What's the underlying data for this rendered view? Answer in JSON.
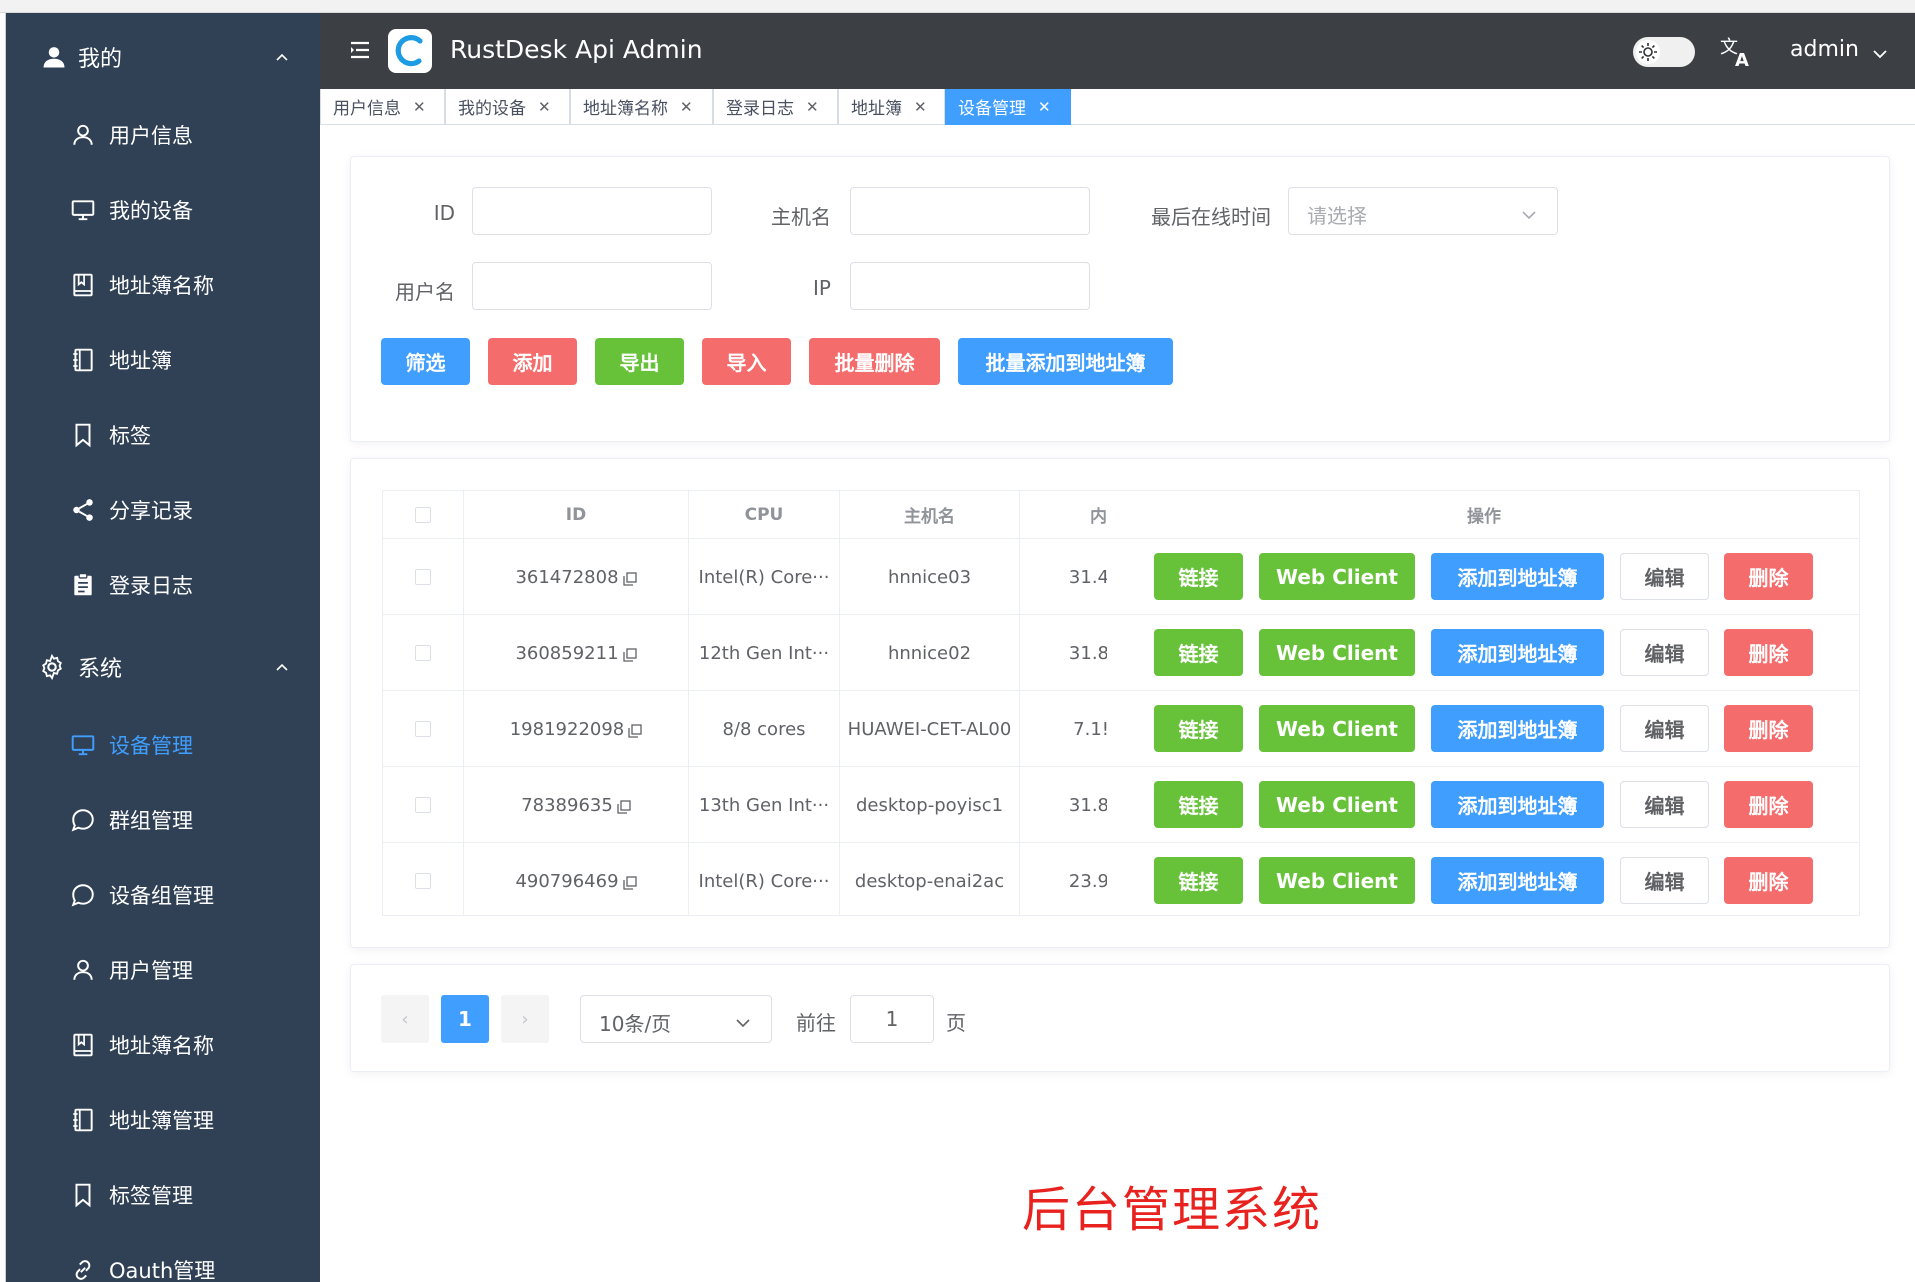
{
  "app": {
    "title": "RustDesk Api Admin",
    "user": "admin"
  },
  "sidebar": {
    "group_mine": "我的",
    "mine_items": [
      {
        "label": "用户信息",
        "icon": "user-icon"
      },
      {
        "label": "我的设备",
        "icon": "monitor-icon"
      },
      {
        "label": "地址簿名称",
        "icon": "book-icon"
      },
      {
        "label": "地址簿",
        "icon": "notebook-icon"
      },
      {
        "label": "标签",
        "icon": "bookmark-icon"
      },
      {
        "label": "分享记录",
        "icon": "share-icon"
      },
      {
        "label": "登录日志",
        "icon": "clipboard-icon"
      }
    ],
    "group_system": "系统",
    "system_items": [
      {
        "label": "设备管理",
        "icon": "monitor-icon",
        "active": true
      },
      {
        "label": "群组管理",
        "icon": "chat-icon"
      },
      {
        "label": "设备组管理",
        "icon": "chat-icon"
      },
      {
        "label": "用户管理",
        "icon": "user-icon"
      },
      {
        "label": "地址簿名称",
        "icon": "book-icon"
      },
      {
        "label": "地址簿管理",
        "icon": "notebook-icon"
      },
      {
        "label": "标签管理",
        "icon": "bookmark-icon"
      },
      {
        "label": "Oauth管理",
        "icon": "link-icon"
      }
    ]
  },
  "tabs": [
    {
      "label": "用户信息"
    },
    {
      "label": "我的设备"
    },
    {
      "label": "地址簿名称"
    },
    {
      "label": "登录日志"
    },
    {
      "label": "地址簿"
    },
    {
      "label": "设备管理",
      "active": true
    }
  ],
  "filters": {
    "id_label": "ID",
    "hostname_label": "主机名",
    "last_online_label": "最后在线时间",
    "last_online_placeholder": "请选择",
    "username_label": "用户名",
    "ip_label": "IP"
  },
  "actions": {
    "filter": "筛选",
    "add": "添加",
    "export": "导出",
    "import": "导入",
    "batch_delete": "批量删除",
    "batch_add_addressbook": "批量添加到地址簿"
  },
  "table": {
    "headers": {
      "id": "ID",
      "cpu": "CPU",
      "hostname": "主机名",
      "memory": "内",
      "ops": "操作"
    },
    "row_buttons": {
      "connect": "链接",
      "web_client": "Web Client",
      "add_to_ab": "添加到地址簿",
      "edit": "编辑",
      "delete": "删除"
    },
    "rows": [
      {
        "id": "361472808",
        "cpu": "Intel(R) Core···",
        "hostname": "hnnice03",
        "memory": "31.4"
      },
      {
        "id": "360859211",
        "cpu": "12th Gen Int···",
        "hostname": "hnnice02",
        "memory": "31.8"
      },
      {
        "id": "1981922098",
        "cpu": "8/8 cores",
        "hostname": "HUAWEI-CET-AL00",
        "memory": "7.1!"
      },
      {
        "id": "78389635",
        "cpu": "13th Gen Int···",
        "hostname": "desktop-poyisc1",
        "memory": "31.8"
      },
      {
        "id": "490796469",
        "cpu": "Intel(R) Core···",
        "hostname": "desktop-enai2ac",
        "memory": "23.9"
      }
    ]
  },
  "pagination": {
    "prev": "‹",
    "current": "1",
    "next": "›",
    "page_size": "10条/页",
    "goto_label": "前往",
    "goto_value": "1",
    "page_suffix": "页"
  },
  "watermark": "后台管理系统",
  "colors": {
    "primary": "#409eff",
    "danger": "#f56c6c",
    "success": "#67c23a",
    "sidebar": "#304156",
    "header": "#3c4045"
  }
}
